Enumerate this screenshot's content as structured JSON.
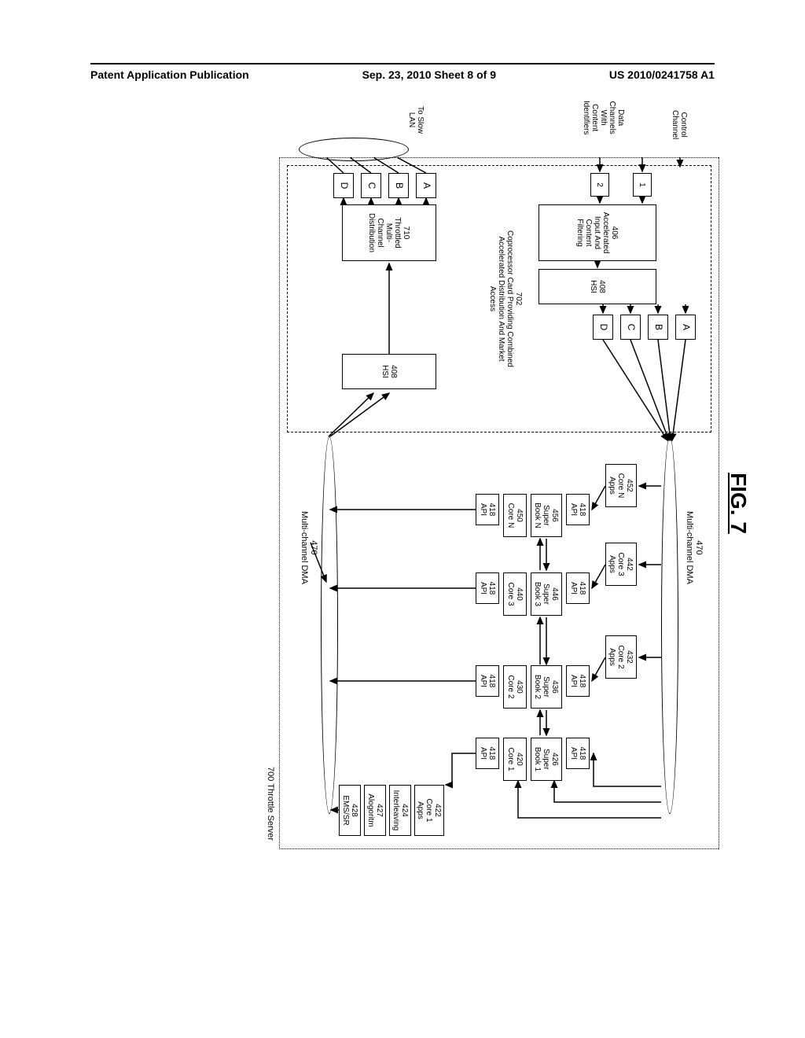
{
  "header": {
    "left": "Patent Application Publication",
    "center": "Sep. 23, 2010  Sheet 8 of 9",
    "right": "US 2010/0241758 A1"
  },
  "figure": {
    "title": "FIG. 7",
    "server_label": "700 Throttle Server",
    "coproc": {
      "main_label": "702\nCoprocessor Card Providing Combined\nAccelerated Distribution And Market\nAccess",
      "accel_input": "406\nAccelerated\nInput And\nContent\nFiltering",
      "hsi_left": "408\nHSI",
      "hsi_right": "408\nHSI",
      "throttled": "710\nThrottled Multi-\nChannel\nDistribution",
      "in1": "1",
      "in2": "2",
      "outA": "A",
      "outB": "B",
      "outC": "C",
      "outD": "D",
      "lanA": "A",
      "lanB": "B",
      "lanC": "C",
      "lanD": "D"
    },
    "dma_top": "470\nMulti-channel DMA",
    "dma_bot": "470\nMulti-channel DMA",
    "ext": {
      "control": "Control\nChannel",
      "data_channels": "Data\nChannels\nWith\nContent\nIdentifiers",
      "to_slow_lan": "To Slow\nLAN"
    },
    "cores": {
      "coreN": {
        "apps": "452\nCore N\nApps",
        "api1": "418\nAPI",
        "super": "456\nSuper\nBook N",
        "core": "450\nCore N",
        "api2": "418\nAPI"
      },
      "core3": {
        "apps": "442\nCore 3\nApps",
        "api1": "418\nAPI",
        "super": "446\nSuper\nBook 3",
        "core": "440\nCore 3",
        "api2": "418\nAPI"
      },
      "core2": {
        "apps": "432\nCore 2\nApps",
        "api1": "418\nAPI",
        "super": "436\nSuper\nBook 2",
        "core": "430\nCore 2",
        "api2": "418\nAPI"
      },
      "core1": {
        "apps": "",
        "api1": "418\nAPI",
        "super": "426\nSuper\nBook 1",
        "core": "420\nCore 1",
        "api2": "418\nAPI"
      },
      "right_col": {
        "core1apps": "422\nCore 1\nApps",
        "interleaving": "424\nInterleaving",
        "algo": "427\nAlogoritm",
        "ems": "428\nEMS/SR"
      }
    }
  }
}
